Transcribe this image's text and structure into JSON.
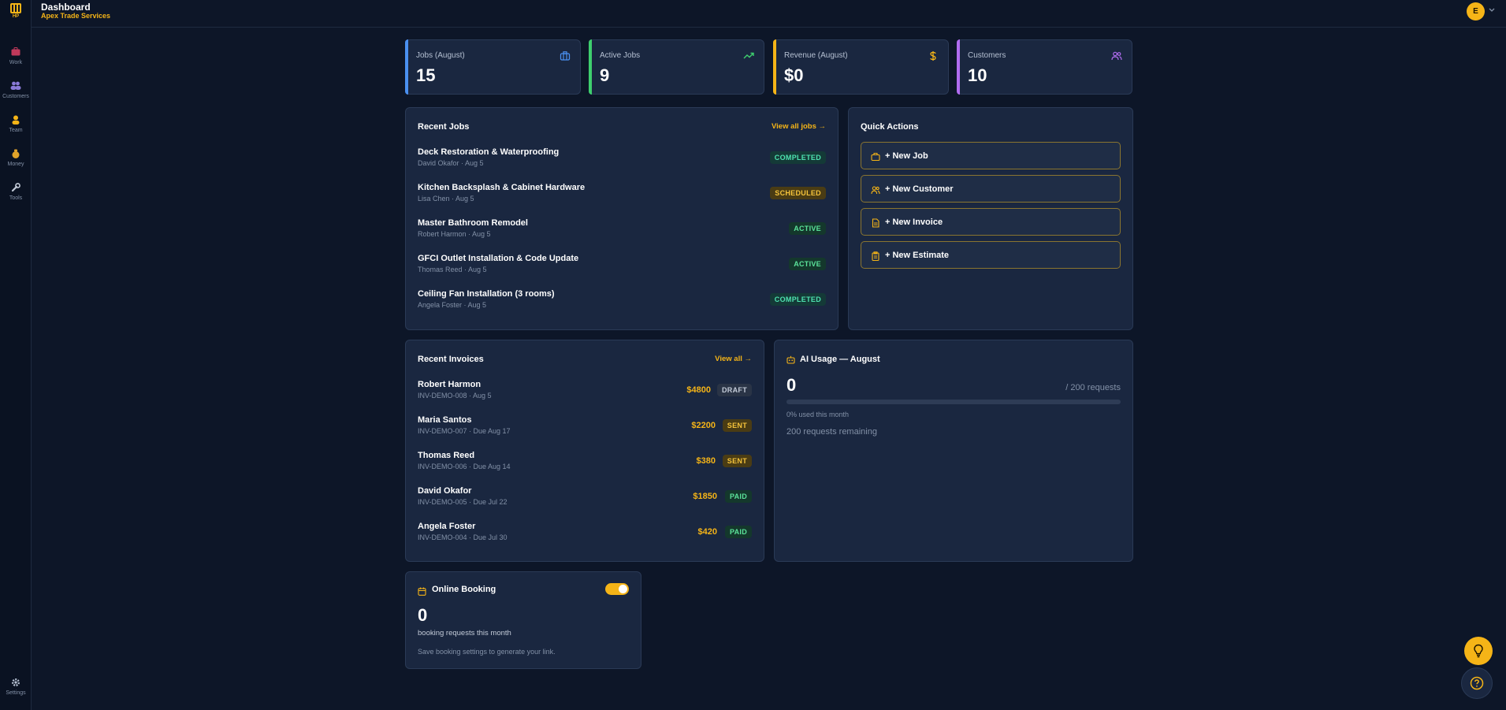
{
  "sidebar": {
    "logo_text": "HP",
    "items": [
      {
        "label": "Work",
        "icon": "briefcase-icon"
      },
      {
        "label": "Customers",
        "icon": "users-icon"
      },
      {
        "label": "Team",
        "icon": "person-icon"
      },
      {
        "label": "Money",
        "icon": "money-bag-icon"
      },
      {
        "label": "Tools",
        "icon": "wrench-icon"
      }
    ],
    "settings": {
      "label": "Settings",
      "icon": "gear-icon"
    }
  },
  "header": {
    "title": "Dashboard",
    "company": "Apex Trade Services",
    "avatar_initial": "E"
  },
  "stats": [
    {
      "label": "Jobs (August)",
      "value": "15",
      "color": "#4a90f0",
      "icon": "briefcase-icon"
    },
    {
      "label": "Active Jobs",
      "value": "9",
      "color": "#3ecf6e",
      "icon": "trending-up-icon"
    },
    {
      "label": "Revenue (August)",
      "value": "$0",
      "color": "#f5b417",
      "icon": "dollar-icon"
    },
    {
      "label": "Customers",
      "value": "10",
      "color": "#b06cf0",
      "icon": "users-icon"
    }
  ],
  "recent_jobs": {
    "title": "Recent Jobs",
    "link": "View all jobs →",
    "items": [
      {
        "title": "Deck Restoration & Waterproofing",
        "sub": "David Okafor · Aug 5",
        "status": "COMPLETED"
      },
      {
        "title": "Kitchen Backsplash & Cabinet Hardware",
        "sub": "Lisa Chen · Aug 5",
        "status": "SCHEDULED"
      },
      {
        "title": "Master Bathroom Remodel",
        "sub": "Robert Harmon · Aug 5",
        "status": "ACTIVE"
      },
      {
        "title": "GFCI Outlet Installation & Code Update",
        "sub": "Thomas Reed · Aug 5",
        "status": "ACTIVE"
      },
      {
        "title": "Ceiling Fan Installation (3 rooms)",
        "sub": "Angela Foster · Aug 5",
        "status": "COMPLETED"
      }
    ]
  },
  "quick_actions": {
    "title": "Quick Actions",
    "items": [
      {
        "label": "+ New Job",
        "icon": "briefcase-icon"
      },
      {
        "label": "+ New Customer",
        "icon": "users-icon"
      },
      {
        "label": "+ New Invoice",
        "icon": "document-icon"
      },
      {
        "label": "+ New Estimate",
        "icon": "clipboard-icon"
      }
    ]
  },
  "recent_invoices": {
    "title": "Recent Invoices",
    "link": "View all →",
    "items": [
      {
        "name": "Robert Harmon",
        "sub": "INV-DEMO-008 · Aug 5",
        "amount": "$4800",
        "status": "DRAFT"
      },
      {
        "name": "Maria Santos",
        "sub": "INV-DEMO-007 · Due Aug 17",
        "amount": "$2200",
        "status": "SENT"
      },
      {
        "name": "Thomas Reed",
        "sub": "INV-DEMO-006 · Due Aug 14",
        "amount": "$380",
        "status": "SENT"
      },
      {
        "name": "David Okafor",
        "sub": "INV-DEMO-005 · Due Jul 22",
        "amount": "$1850",
        "status": "PAID"
      },
      {
        "name": "Angela Foster",
        "sub": "INV-DEMO-004 · Due Jul 30",
        "amount": "$420",
        "status": "PAID"
      }
    ]
  },
  "ai_usage": {
    "title": "AI Usage — August",
    "used": "0",
    "max": "/ 200 requests",
    "percent_used": 0,
    "percent_text": "0% used this month",
    "remaining": "200 requests remaining"
  },
  "online_booking": {
    "title": "Online Booking",
    "enabled": true,
    "count": "0",
    "sub": "booking requests this month",
    "note": "Save booking settings to generate your link."
  },
  "colors": {
    "accent": "#f5b417",
    "background": "#0d1628",
    "card": "#1a2740"
  }
}
